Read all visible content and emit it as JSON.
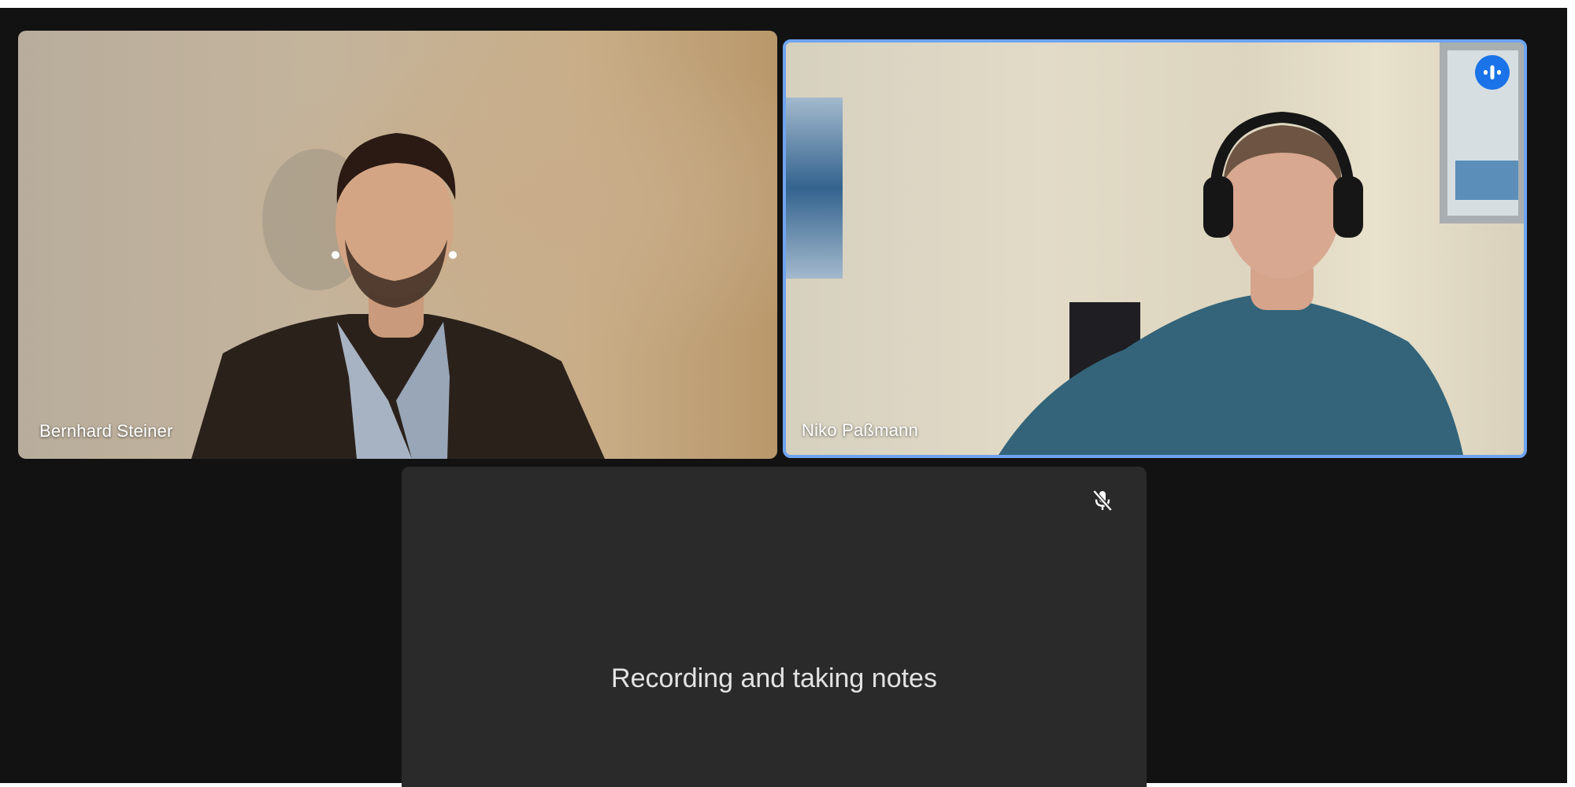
{
  "participants": [
    {
      "name": "Bernhard Steiner"
    },
    {
      "name": "Niko Paßmann",
      "speaking": true
    },
    {
      "placeholder_text": "Recording and taking notes",
      "muted": true
    }
  ],
  "icons": {
    "speaking": "audio-wave-icon",
    "muted": "mic-off-icon"
  },
  "colors": {
    "background": "#121212",
    "active_border": "#6ea4f0",
    "speaking_badge": "#1a73e8",
    "placeholder_tile": "#2a2a2a"
  }
}
